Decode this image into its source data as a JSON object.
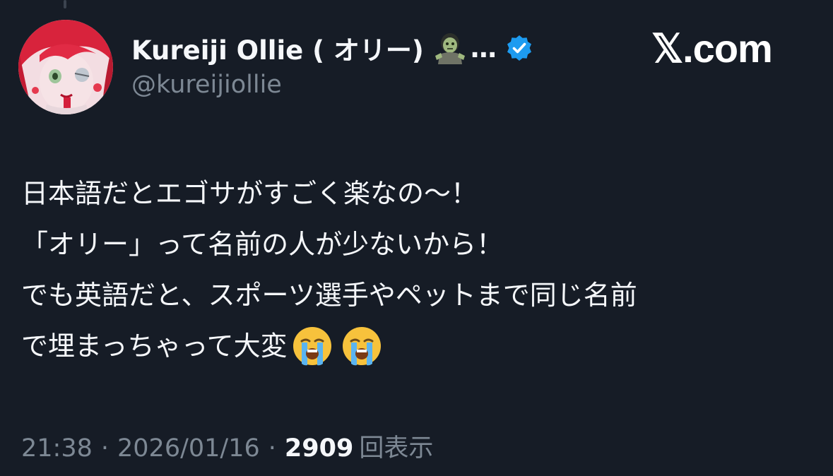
{
  "author": {
    "display_name": "Kureiji Ollie ( オリー)",
    "ellipsis": "…",
    "handle": "@kureijiollie",
    "emoji": "zombie-icon",
    "verified": true,
    "verified_color": "#1d9bf0"
  },
  "brand": {
    "label": "𝕏.com"
  },
  "tweet": {
    "lines": [
      "日本語だとエゴサがすごく楽なの〜！",
      "「オリー」って名前の人が少ないから！",
      "でも英語だと、スポーツ選手やペットまで同じ名前",
      "で埋まっちゃって大変"
    ],
    "trailing_emojis": [
      "loudly-crying-face-icon",
      "loudly-crying-face-icon"
    ]
  },
  "meta": {
    "time": "21:38",
    "separator": "·",
    "date": "2026/01/16",
    "views_count": "2909",
    "views_label": "回表示"
  },
  "colors": {
    "background": "#161c26",
    "primary_text": "#f5f7fa",
    "secondary_text": "#7d8894"
  }
}
